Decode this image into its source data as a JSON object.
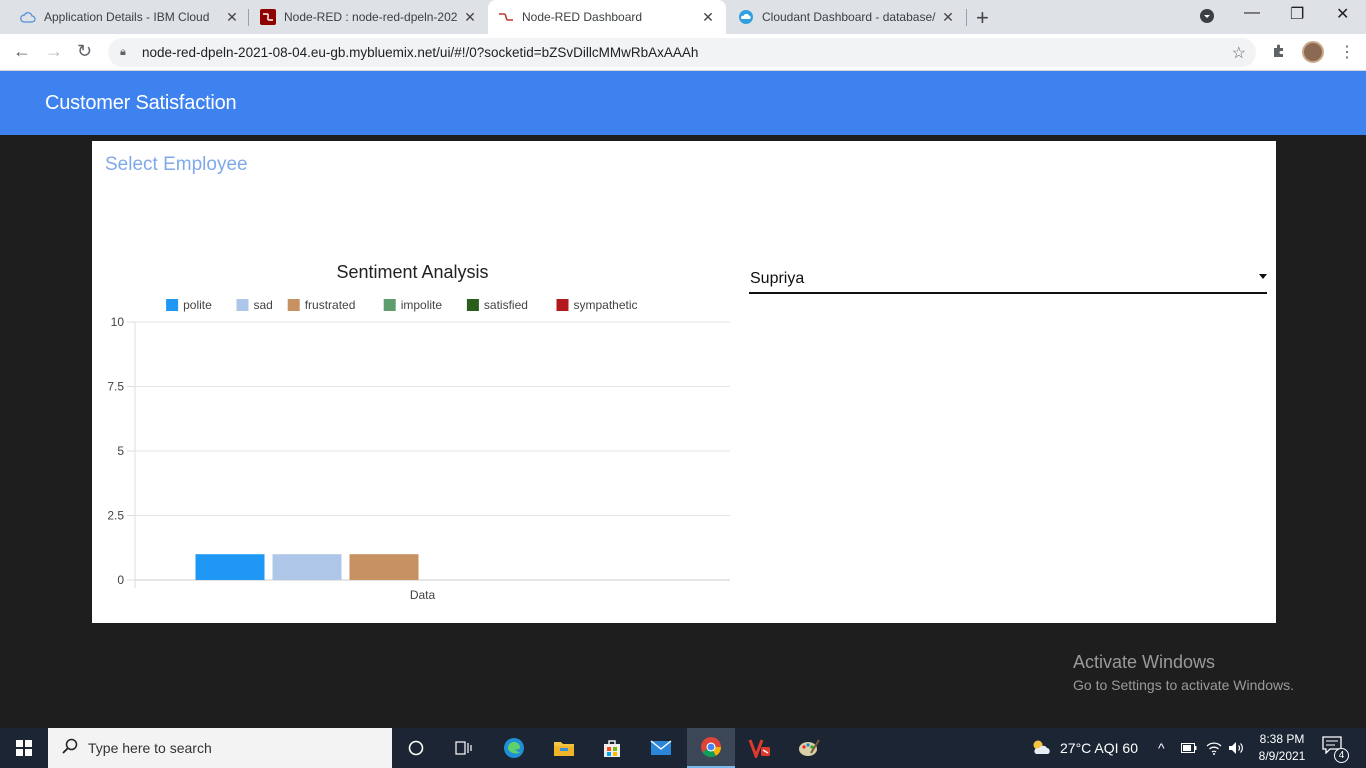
{
  "browser": {
    "tabs": [
      {
        "title": "Application Details - IBM Cloud",
        "icon": "cloud-icon"
      },
      {
        "title": "Node-RED : node-red-dpeln-202",
        "icon": "node-red-icon"
      },
      {
        "title": "Node-RED Dashboard",
        "icon": "node-red-icon",
        "active": true
      },
      {
        "title": "Cloudant Dashboard - database/",
        "icon": "cloudant-icon"
      }
    ],
    "url": "node-red-dpeln-2021-08-04.eu-gb.mybluemix.net/ui/#!/0?socketid=bZSvDillcMMwRbAxAAAh"
  },
  "app": {
    "header_title": "Customer Satisfaction",
    "group_title": "Select Employee",
    "accent_color": "#3e82f0"
  },
  "dropdown": {
    "selected": "Supriya"
  },
  "chart_data": {
    "type": "bar",
    "title": "Sentiment Analysis",
    "categories": [
      "Data"
    ],
    "xlabel": "",
    "ylabel": "",
    "ylim": [
      0,
      10
    ],
    "yticks": [
      "0",
      "2.5",
      "5",
      "7.5",
      "10"
    ],
    "grid": true,
    "legend_position": "top",
    "series": [
      {
        "name": "polite",
        "color": "#1f97f4",
        "values": [
          1
        ]
      },
      {
        "name": "sad",
        "color": "#aec7e8",
        "values": [
          1
        ]
      },
      {
        "name": "frustrated",
        "color": "#c79162",
        "values": [
          1
        ]
      },
      {
        "name": "impolite",
        "color": "#5f9c6e",
        "values": [
          0
        ]
      },
      {
        "name": "satisfied",
        "color": "#2b5e1b",
        "values": [
          0
        ]
      },
      {
        "name": "sympathetic",
        "color": "#b2191c",
        "values": [
          0
        ]
      }
    ]
  },
  "watermark": {
    "line1": "Activate Windows",
    "line2": "Go to Settings to activate Windows."
  },
  "taskbar": {
    "search_placeholder": "Type here to search",
    "weather": "27°C  AQI 60",
    "time": "8:38 PM",
    "date": "8/9/2021",
    "notifications": "4"
  }
}
